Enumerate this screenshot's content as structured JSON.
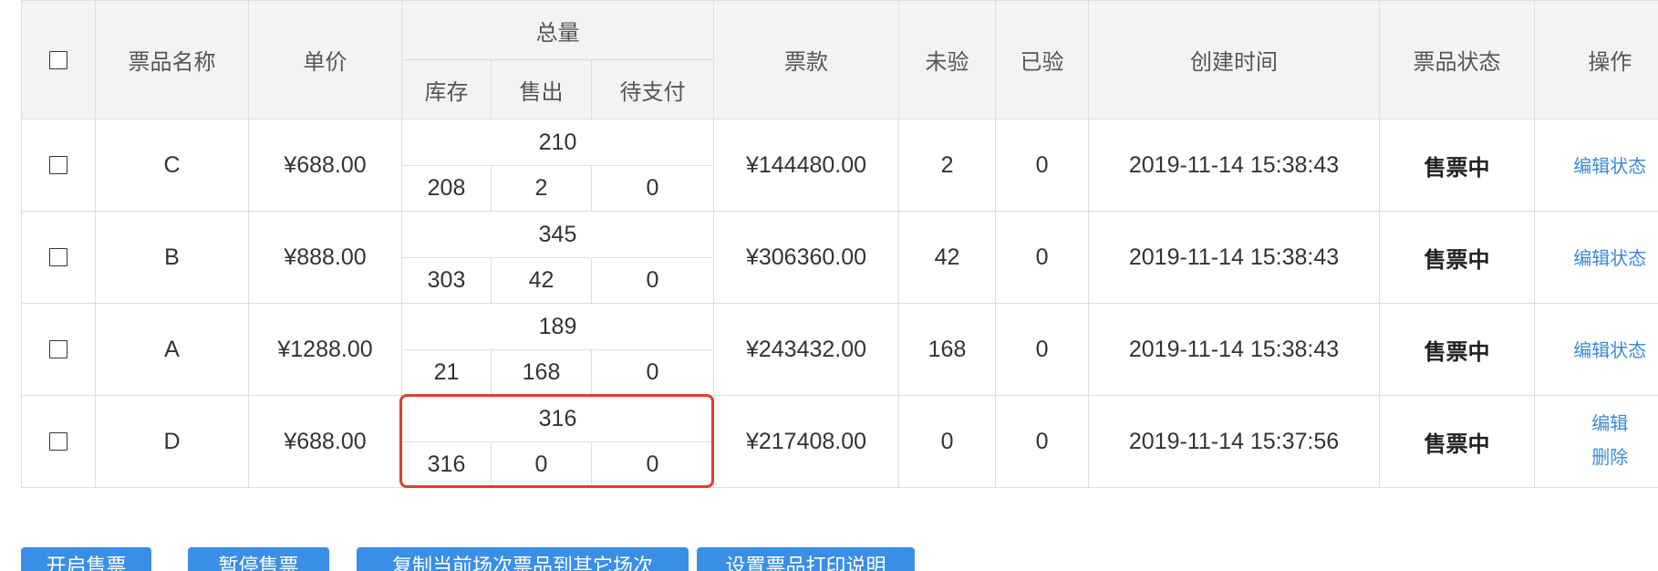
{
  "colors": {
    "accent": "#3a8ee6",
    "link": "#3b8ad8",
    "highlight": "#e0402d",
    "header_bg": "#f3f3f3",
    "border": "#dedede",
    "text": "#333333"
  },
  "table": {
    "select_all_checked": false,
    "headers": {
      "name": "票品名称",
      "price": "单价",
      "total_group": "总量",
      "stock": "库存",
      "sold": "售出",
      "pending": "待支付",
      "amount": "票款",
      "unverified": "未验",
      "verified": "已验",
      "created": "创建时间",
      "status": "票品状态",
      "actions": "操作"
    },
    "rows": [
      {
        "checked": false,
        "name": "C",
        "price": "¥688.00",
        "total": 210,
        "stock": 208,
        "sold": 2,
        "pending": 0,
        "amount": "¥144480.00",
        "unverified": 2,
        "verified": 0,
        "created": "2019-11-14 15:38:43",
        "status": "售票中",
        "actions": [
          "编辑状态"
        ]
      },
      {
        "checked": false,
        "name": "B",
        "price": "¥888.00",
        "total": 345,
        "stock": 303,
        "sold": 42,
        "pending": 0,
        "amount": "¥306360.00",
        "unverified": 42,
        "verified": 0,
        "created": "2019-11-14 15:38:43",
        "status": "售票中",
        "actions": [
          "编辑状态"
        ]
      },
      {
        "checked": false,
        "name": "A",
        "price": "¥1288.00",
        "total": 189,
        "stock": 21,
        "sold": 168,
        "pending": 0,
        "amount": "¥243432.00",
        "unverified": 168,
        "verified": 0,
        "created": "2019-11-14 15:38:43",
        "status": "售票中",
        "actions": [
          "编辑状态"
        ]
      },
      {
        "checked": false,
        "name": "D",
        "price": "¥688.00",
        "total": 316,
        "stock": 316,
        "sold": 0,
        "pending": 0,
        "amount": "¥217408.00",
        "unverified": 0,
        "verified": 0,
        "created": "2019-11-14 15:37:56",
        "status": "售票中",
        "actions": [
          "编辑",
          "删除"
        ]
      }
    ]
  },
  "toolbar": {
    "buttons": [
      {
        "label": "开启售票"
      },
      {
        "label": "暂停售票"
      },
      {
        "label": "复制当前场次票品到其它场次"
      },
      {
        "label": "设置票品打印说明"
      }
    ]
  }
}
